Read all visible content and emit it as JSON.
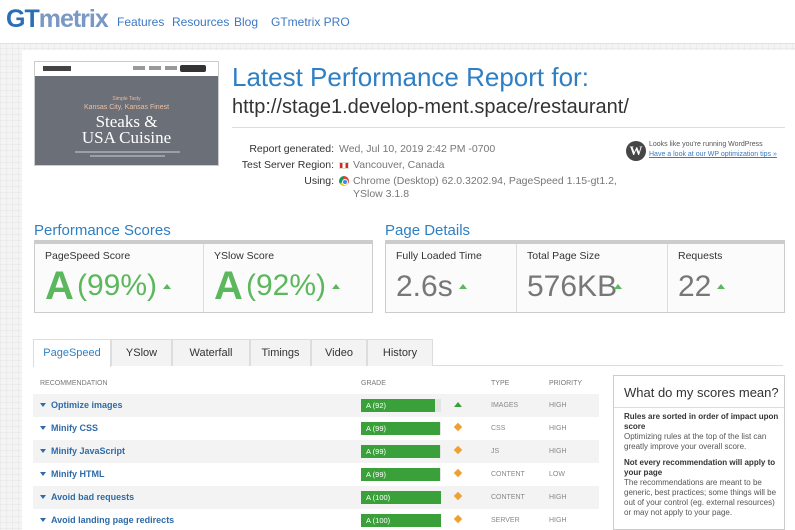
{
  "topbar": {
    "logo_gt": "GT",
    "logo_metrix": "metrix",
    "nav": [
      "Features",
      "Resources",
      "Blog",
      "GTmetrix PRO"
    ]
  },
  "thumbnail": {
    "tagline_small": "Simple Tasty",
    "tagline": "Kansas City, Kansas Finest",
    "title_line1": "Steaks &",
    "title_line2": "USA Cuisine"
  },
  "report": {
    "title": "Latest Performance Report for:",
    "url": "http://stage1.develop-ment.space/restaurant/",
    "generated_label": "Report generated:",
    "generated_value": "Wed, Jul 10, 2019 2:42 PM -0700",
    "server_label": "Test Server Region:",
    "server_value": "Vancouver, Canada",
    "using_label": "Using:",
    "using_line1": "Chrome (Desktop) 62.0.3202.94, PageSpeed 1.15-gt1.2,",
    "using_line2": "YSlow 3.1.8"
  },
  "wordpress": {
    "icon": "wordpress-icon",
    "text": "Looks like you're running WordPress",
    "link": "Have a look at our WP optimization tips »"
  },
  "performance": {
    "title": "Performance Scores",
    "pagespeed_label": "PageSpeed Score",
    "pagespeed_grade": "A",
    "pagespeed_pct": "(99%)",
    "yslow_label": "YSlow Score",
    "yslow_grade": "A",
    "yslow_pct": "(92%)"
  },
  "details": {
    "title": "Page Details",
    "load_label": "Fully Loaded Time",
    "load_value": "2.6s",
    "size_label": "Total Page Size",
    "size_value": "576KB",
    "req_label": "Requests",
    "req_value": "22"
  },
  "tabs": [
    "PageSpeed",
    "YSlow",
    "Waterfall",
    "Timings",
    "Video",
    "History"
  ],
  "table": {
    "headers": [
      "Recommendation",
      "Grade",
      "Type",
      "Priority"
    ],
    "rows": [
      {
        "name": "Optimize images",
        "grade": "A (92)",
        "score": 92,
        "trend": "up",
        "type": "Images",
        "priority": "High"
      },
      {
        "name": "Minify CSS",
        "grade": "A (99)",
        "score": 99,
        "trend": "same",
        "type": "CSS",
        "priority": "High"
      },
      {
        "name": "Minify JavaScript",
        "grade": "A (99)",
        "score": 99,
        "trend": "same",
        "type": "JS",
        "priority": "High"
      },
      {
        "name": "Minify HTML",
        "grade": "A (99)",
        "score": 99,
        "trend": "same",
        "type": "Content",
        "priority": "Low"
      },
      {
        "name": "Avoid bad requests",
        "grade": "A (100)",
        "score": 100,
        "trend": "same",
        "type": "Content",
        "priority": "High"
      },
      {
        "name": "Avoid landing page redirects",
        "grade": "A (100)",
        "score": 100,
        "trend": "same",
        "type": "Server",
        "priority": "High"
      }
    ]
  },
  "side": {
    "title": "What do my scores mean?",
    "b1": "Rules are sorted in order of impact upon score",
    "p1": "Optimizing rules at the top of the list can greatly improve your overall score.",
    "b2": "Not every recommendation will apply to your page",
    "p2": "The recommendations are meant to be generic, best practices; some things will be out of your control (eg. external resources) or may not apply to your page."
  },
  "colors": {
    "brand_blue": "#2e7fc3",
    "grade_green": "#3aa03a",
    "score_green": "#5cb85c",
    "trend_orange": "#f0a030"
  }
}
